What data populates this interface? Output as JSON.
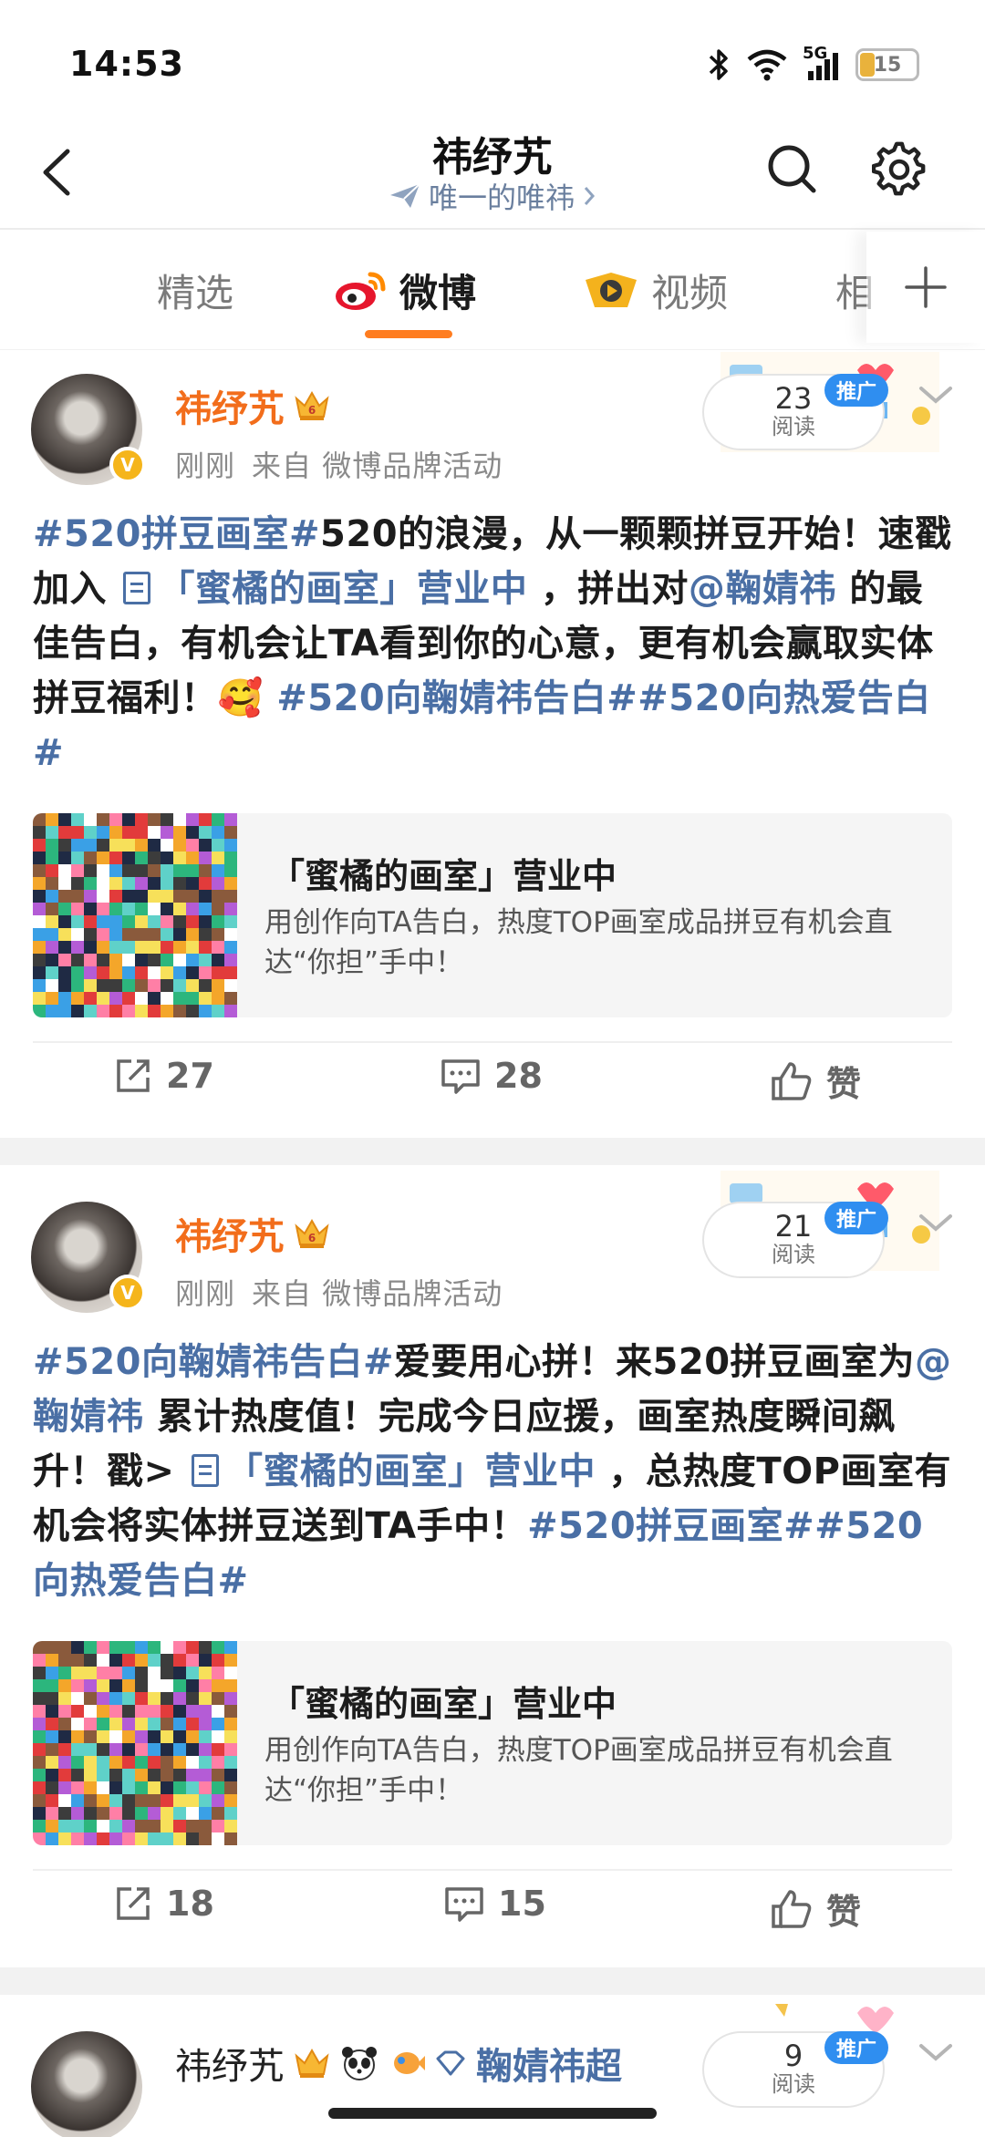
{
  "status_bar": {
    "time": "14:53",
    "network": "5G",
    "battery": "15"
  },
  "header": {
    "title": "祎纾艽",
    "subtitle": "唯一的唯祎"
  },
  "tabs": [
    {
      "label": "精选"
    },
    {
      "label": "微博"
    },
    {
      "label": "视频"
    },
    {
      "label": "相"
    }
  ],
  "posts": [
    {
      "author": "祎纾艽",
      "time": "刚刚",
      "source": "来自 微博品牌活动",
      "read_count": "23",
      "read_label": "阅读",
      "promo_tag": "推广",
      "text": {
        "t1": "#520拼豆画室#",
        "t2": "520的浪漫，从一颗颗拼豆开始！速戳加入",
        "link": "「蜜橘的画室」营业中",
        "t3": "，拼出对",
        "mention": "@鞠婧祎",
        "t4": "的最佳告白，有机会让TA看到你的心意，更有机会赢取实体拼豆福利！",
        "emoji": "🥰",
        "t5": "#520向鞠婧祎告白#",
        "t6": "#520向热爱告白#"
      },
      "card": {
        "title": "「蜜橘的画室」营业中",
        "desc": "用创作向TA告白，热度TOP画室成品拼豆有机会直达“你担”手中！"
      },
      "reposts": "27",
      "comments": "28",
      "likes": "赞"
    },
    {
      "author": "祎纾艽",
      "time": "刚刚",
      "source": "来自 微博品牌活动",
      "read_count": "21",
      "read_label": "阅读",
      "promo_tag": "推广",
      "text": {
        "t1": "#520向鞠婧祎告白#",
        "t2": "爱要用心拼！来520拼豆画室为",
        "mention": "@鞠婧祎",
        "t3": "累计热度值！完成今日应援，画室热度瞬间飙升！戳>",
        "link": "「蜜橘的画室」营业中",
        "t4": "，总热度TOP画室有机会将实体拼豆送到TA手中！",
        "t5": "#520拼豆画室#",
        "t6": "#520向热爱告白#"
      },
      "card": {
        "title": "「蜜橘的画室」营业中",
        "desc": "用创作向TA告白，热度TOP画室成品拼豆有机会直达“你担”手中！"
      },
      "reposts": "18",
      "comments": "15",
      "likes": "赞"
    },
    {
      "author": "祎纾艽",
      "super_topic": "鞠婧祎超",
      "read_count": "9",
      "read_label": "阅读",
      "promo_tag": "推广"
    }
  ],
  "colors": {
    "accent": "#ff7d20",
    "author": "#f26d1b",
    "topic": "#4a6fa5",
    "promo": "#2f8ef0"
  }
}
